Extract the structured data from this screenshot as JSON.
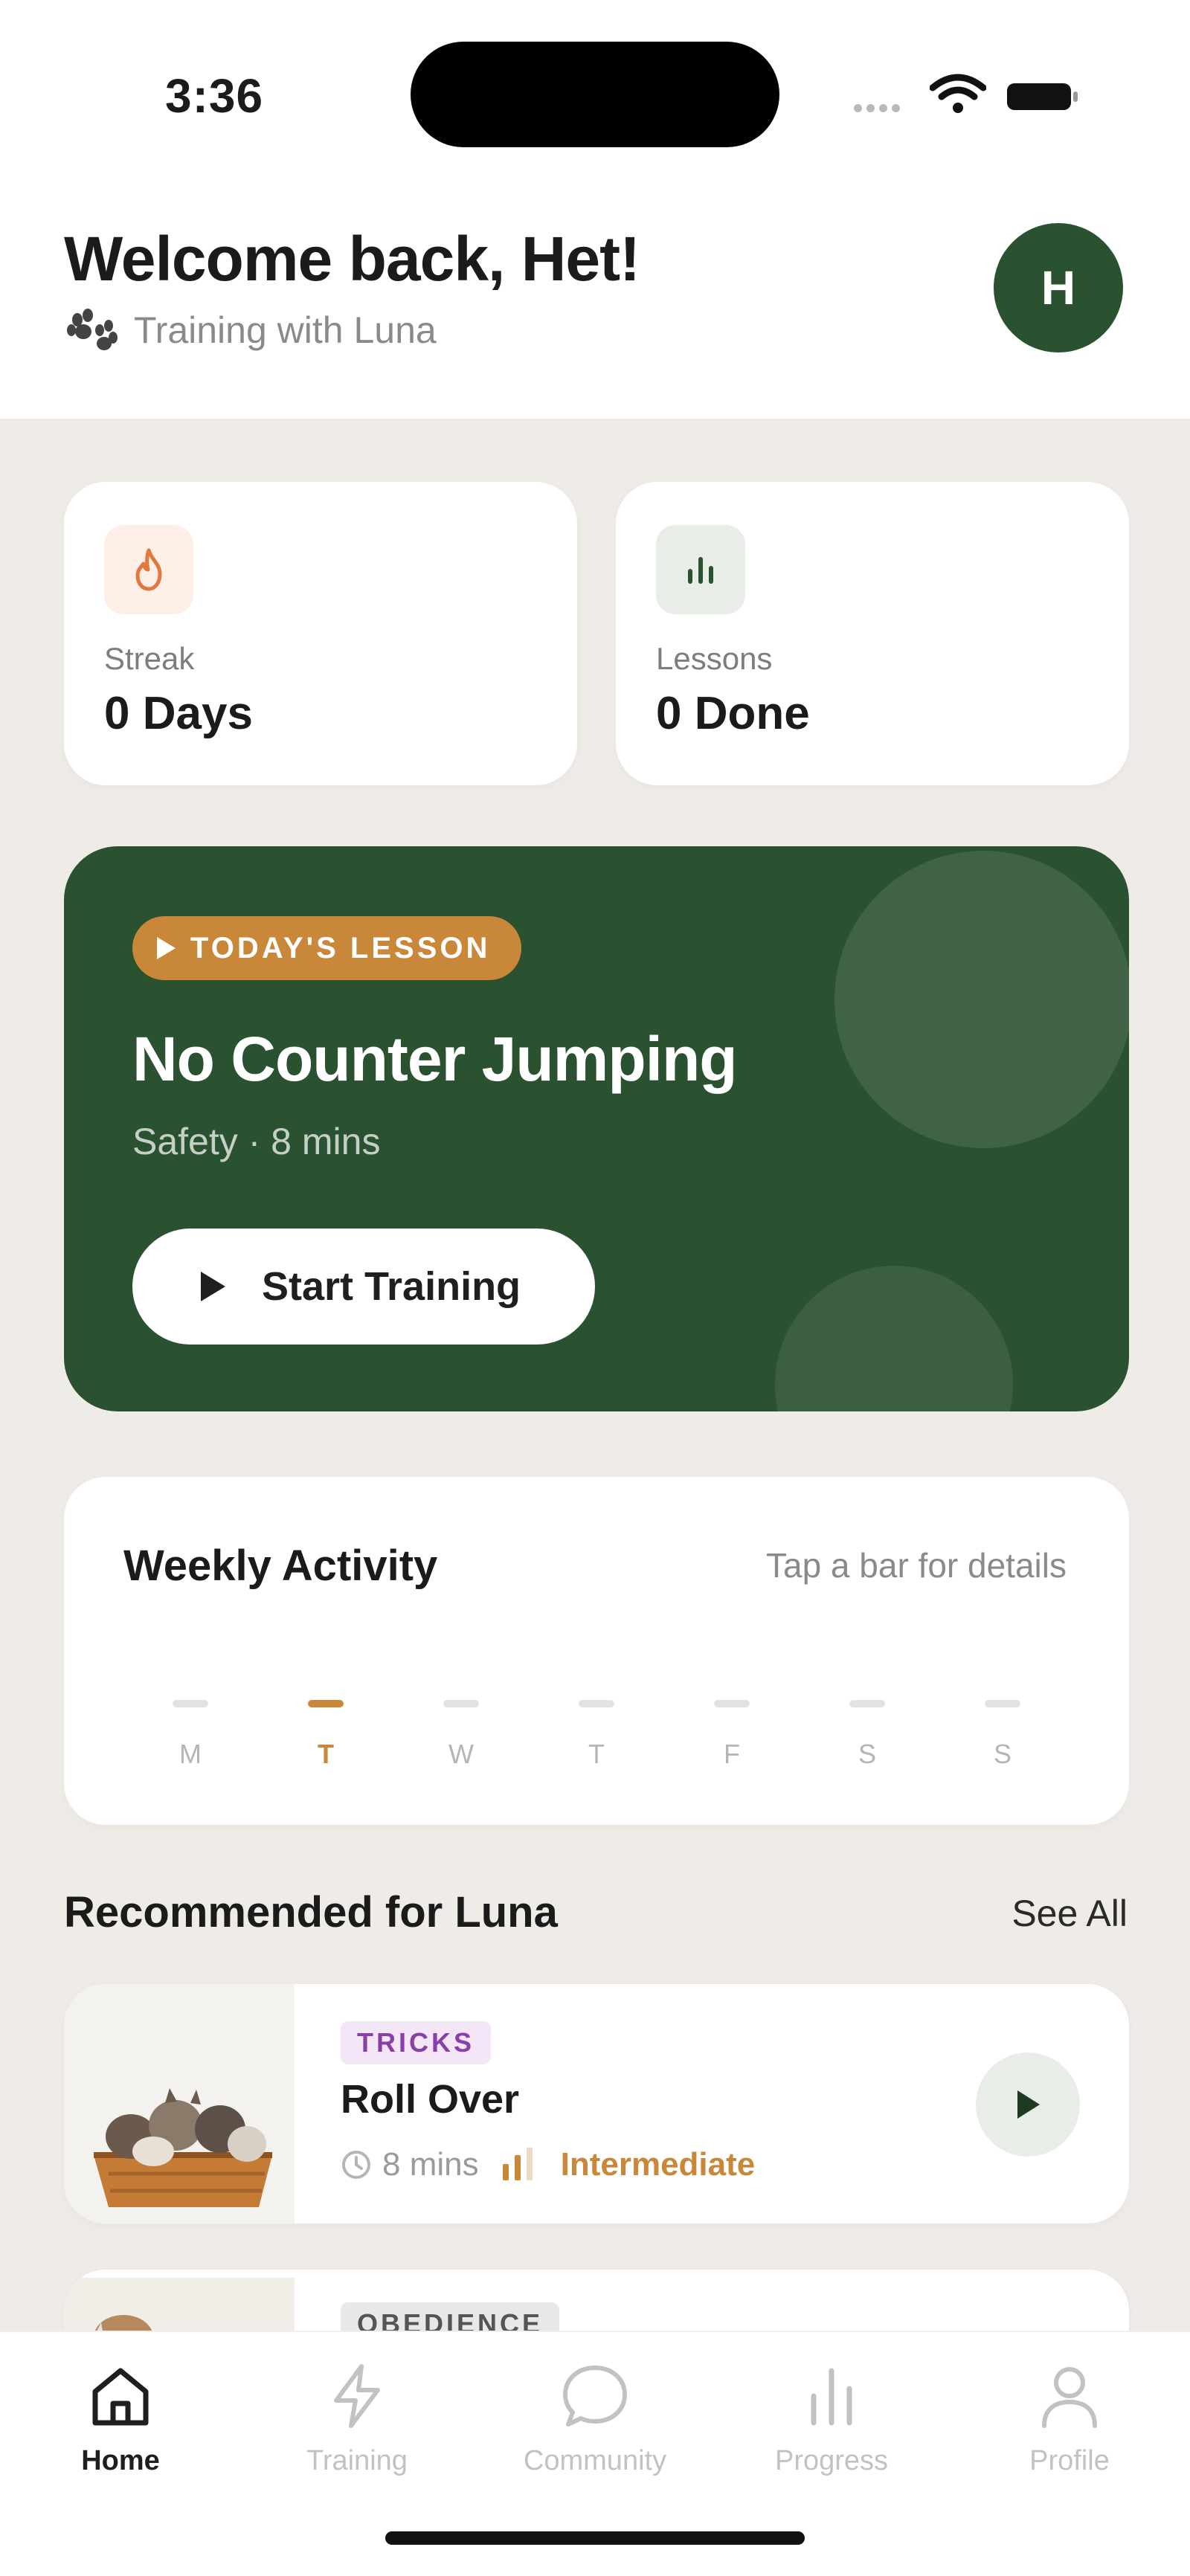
{
  "status_bar": {
    "time": "3:36"
  },
  "header": {
    "welcome": "Welcome back, Het!",
    "subtitle": "Training with Luna",
    "avatar_initial": "H"
  },
  "stats": [
    {
      "label": "Streak",
      "value": "0 Days",
      "icon": "flame-icon",
      "icon_bg": "#fdeee8",
      "icon_color": "#e07a3c"
    },
    {
      "label": "Lessons",
      "value": "0 Done",
      "icon": "bar-chart-icon",
      "icon_bg": "#e9ede8",
      "icon_color": "#2b5230"
    }
  ],
  "todays_lesson": {
    "badge": "TODAY'S LESSON",
    "title": "No Counter Jumping",
    "meta": "Safety · 8 mins",
    "button": "Start Training"
  },
  "weekly": {
    "title": "Weekly Activity",
    "hint": "Tap a bar for details",
    "days": [
      "M",
      "T",
      "W",
      "T",
      "F",
      "S",
      "S"
    ],
    "active_day_index": 1
  },
  "recommended": {
    "title": "Recommended for Luna",
    "see_all": "See All",
    "items": [
      {
        "tag": "TRICKS",
        "name": "Roll Over",
        "duration": "8 mins",
        "level": "Intermediate"
      },
      {
        "tag": "OBEDIENCE"
      }
    ]
  },
  "tabs": [
    {
      "label": "Home",
      "icon": "home-icon",
      "active": true
    },
    {
      "label": "Training",
      "icon": "lightning-icon"
    },
    {
      "label": "Community",
      "icon": "chat-bubble-icon"
    },
    {
      "label": "Progress",
      "icon": "bar-chart-icon"
    },
    {
      "label": "Profile",
      "icon": "person-icon"
    }
  ],
  "colors": {
    "brand_green": "#2b5230",
    "accent_orange": "#c9873a",
    "background": "#efece7"
  }
}
